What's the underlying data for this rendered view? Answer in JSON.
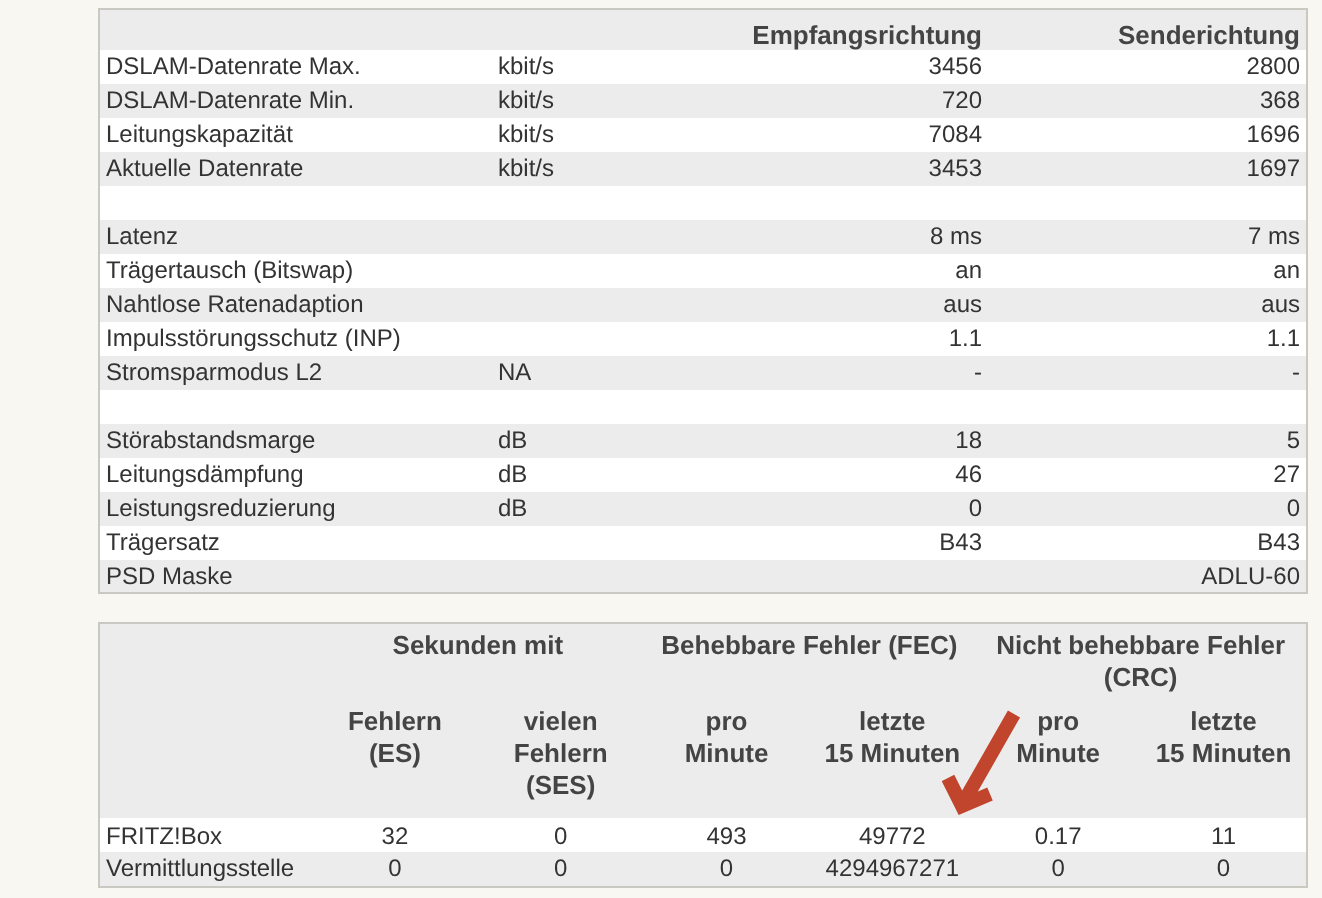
{
  "line_table": {
    "columns": [
      "Empfangsrichtung",
      "Senderichtung"
    ],
    "rows": [
      {
        "kind": "data",
        "label": "DSLAM-Datenrate Max.",
        "unit": "kbit/s",
        "downstream": "3456",
        "upstream": "2800"
      },
      {
        "kind": "data",
        "label": "DSLAM-Datenrate Min.",
        "unit": "kbit/s",
        "downstream": "720",
        "upstream": "368"
      },
      {
        "kind": "data",
        "label": "Leitungskapazität",
        "unit": "kbit/s",
        "downstream": "7084",
        "upstream": "1696"
      },
      {
        "kind": "data",
        "label": "Aktuelle Datenrate",
        "unit": "kbit/s",
        "downstream": "3453",
        "upstream": "1697"
      },
      {
        "kind": "spacer"
      },
      {
        "kind": "data",
        "label": "Latenz",
        "downstream": "8 ms",
        "upstream": "7 ms"
      },
      {
        "kind": "data",
        "label": "Trägertausch (Bitswap)",
        "downstream": "an",
        "upstream": "an"
      },
      {
        "kind": "data",
        "label": "Nahtlose Ratenadaption",
        "downstream": "aus",
        "upstream": "aus"
      },
      {
        "kind": "data",
        "label": "Impulsstörungsschutz (INP)",
        "downstream": "1.1",
        "upstream": "1.1"
      },
      {
        "kind": "data",
        "label": "Stromsparmodus L2",
        "unit": "NA",
        "downstream": "-",
        "upstream": "-"
      },
      {
        "kind": "spacer"
      },
      {
        "kind": "data",
        "label": "Störabstandsmarge",
        "unit": "dB",
        "downstream": "18",
        "upstream": "5"
      },
      {
        "kind": "data",
        "label": "Leitungsdämpfung",
        "unit": "dB",
        "downstream": "46",
        "upstream": "27"
      },
      {
        "kind": "data",
        "label": "Leistungsreduzierung",
        "unit": "dB",
        "downstream": "0",
        "upstream": "0"
      },
      {
        "kind": "data",
        "label": "Trägersatz",
        "downstream": "B43",
        "upstream": "B43"
      },
      {
        "kind": "data",
        "label": "PSD Maske",
        "upstream": "ADLU-60"
      }
    ]
  },
  "error_table": {
    "groups": [
      "Sekunden mit",
      "Behebbare Fehler (FEC)",
      "Nicht behebbare Fehler\n(CRC)"
    ],
    "columns": [
      "Fehlern\n(ES)",
      "vielen\nFehlern\n(SES)",
      "pro\nMinute",
      "letzte\n15 Minuten",
      "pro\nMinute",
      "letzte\n15 Minuten"
    ],
    "rows": [
      {
        "label": "FRITZ!Box",
        "values": [
          "32",
          "0",
          "493",
          "49772",
          "0.17",
          "11"
        ]
      },
      {
        "label": "Vermittlungsstelle",
        "values": [
          "0",
          "0",
          "0",
          "4294967271",
          "0",
          "0"
        ]
      }
    ]
  }
}
